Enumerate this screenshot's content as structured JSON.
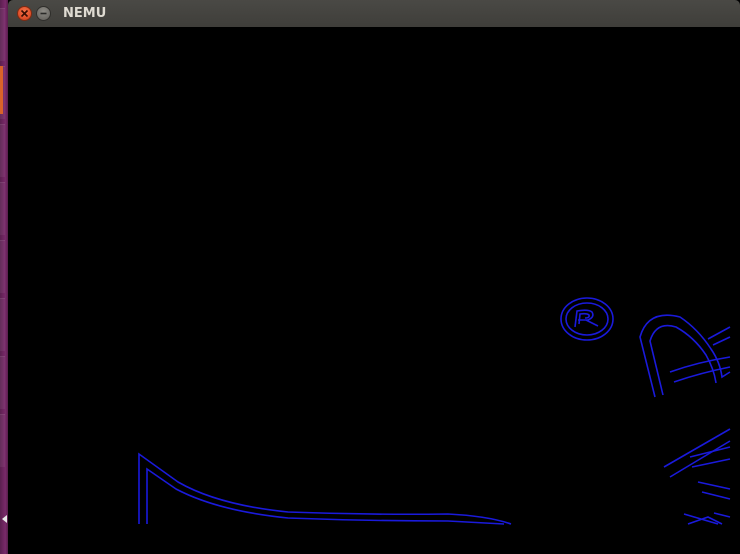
{
  "window": {
    "title": "NEMU"
  },
  "icons": {
    "close": "close-icon",
    "minimize": "minimize-icon",
    "launcher_arrow": "triangle-left-icon"
  },
  "colors": {
    "outline": "#1a1adb",
    "background": "#000000",
    "titlebar": "#3f3e3a",
    "close": "#e2512b"
  }
}
